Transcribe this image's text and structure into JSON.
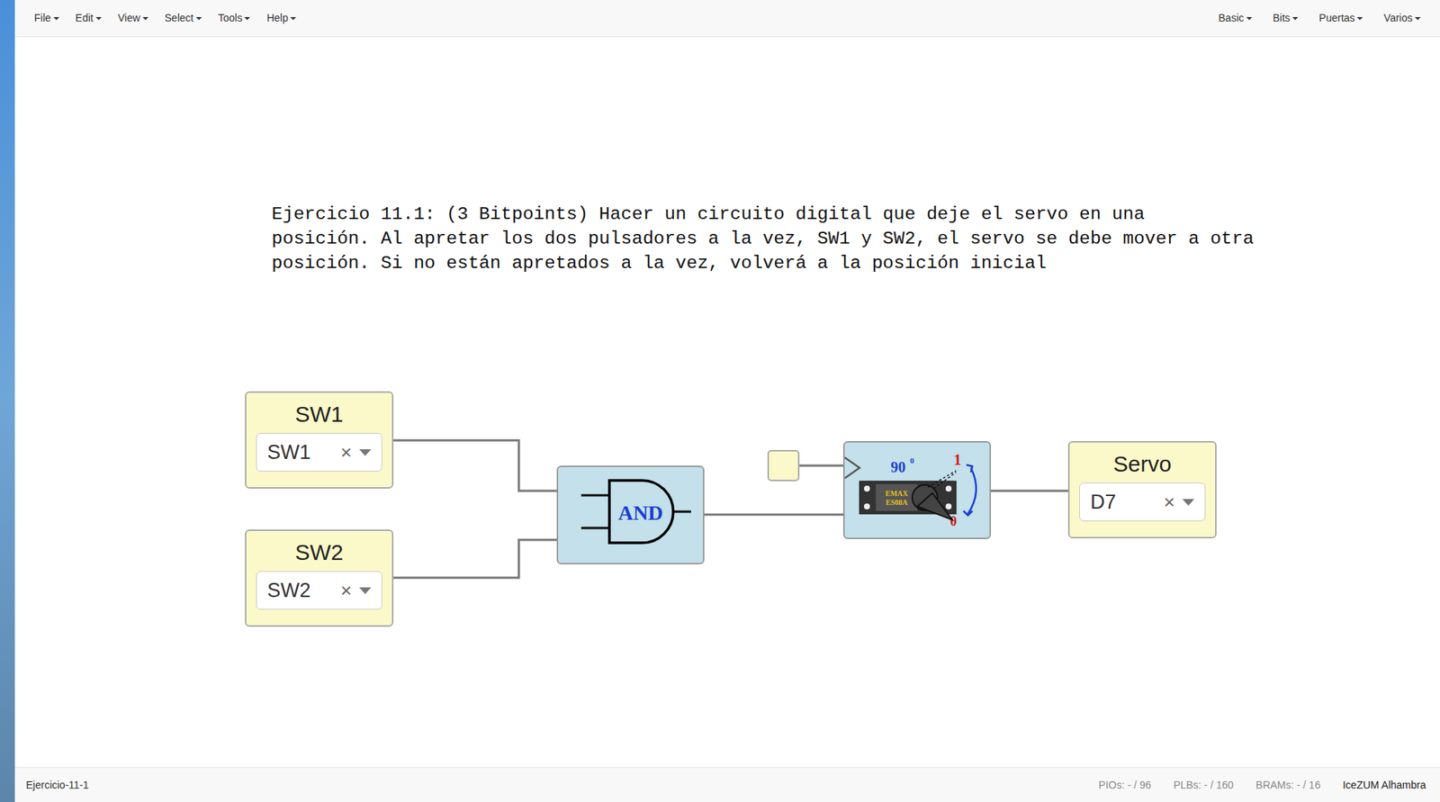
{
  "menu": {
    "left": [
      "File",
      "Edit",
      "View",
      "Select",
      "Tools",
      "Help"
    ],
    "right": [
      "Basic",
      "Bits",
      "Puertas",
      "Varios"
    ]
  },
  "comment": {
    "lines": [
      "Ejercicio 11.1: (3 Bitpoints) Hacer un circuito digital que deje el servo en una",
      "posición. Al apretar los dos pulsadores a la vez, SW1 y SW2, el servo se debe mover a otra",
      "posición. Si no están apretados a la vez, volverá a la posición inicial"
    ]
  },
  "inputs": [
    {
      "title": "SW1",
      "value": "SW1",
      "clear": "×"
    },
    {
      "title": "SW2",
      "value": "SW2",
      "clear": "×"
    }
  ],
  "gate": {
    "label": "AND"
  },
  "servo_block": {
    "angle": "90",
    "degree": "0",
    "high": "1",
    "low": "0",
    "brand": "EMAX",
    "model": "ES08A"
  },
  "output": {
    "title": "Servo",
    "value": "D7",
    "clear": "×"
  },
  "status_bar": {
    "file": "Ejercicio-11-1",
    "stats": [
      "PIOs: - / 96",
      "PLBs: - / 160",
      "BRAMs: - / 16"
    ],
    "board": "IceZUM Alhambra"
  }
}
